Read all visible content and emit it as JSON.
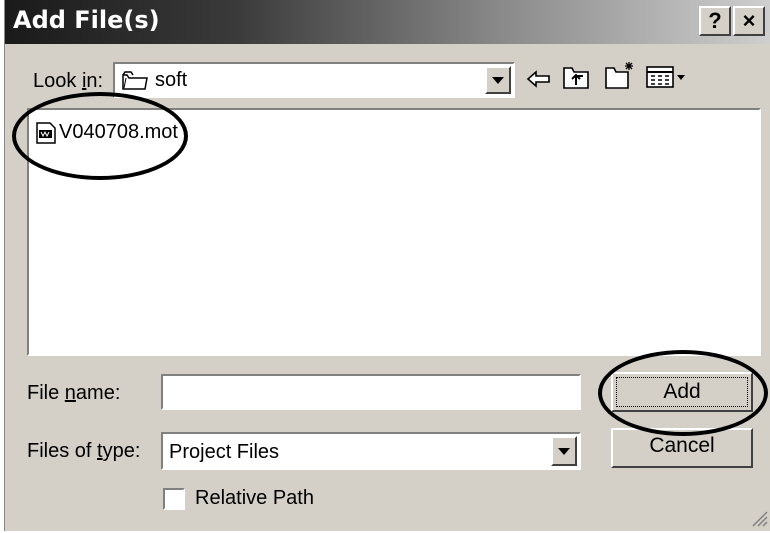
{
  "window": {
    "title": "Add File(s)",
    "help_label": "?",
    "close_label": "×"
  },
  "lookin": {
    "label_pre": "Look ",
    "label_u": "i",
    "label_post": "n:",
    "folder": "soft",
    "icons": [
      "back-arrow-icon",
      "up-folder-icon",
      "new-folder-icon",
      "view-menu-icon"
    ]
  },
  "files": [
    {
      "name": "V040708.mot",
      "icon": "mot-file-icon"
    }
  ],
  "filename": {
    "label_pre": "File ",
    "label_u": "n",
    "label_post": "ame:",
    "value": ""
  },
  "filetype": {
    "label_pre": "Files of ",
    "label_u": "t",
    "label_post": "ype:",
    "selected": "Project Files"
  },
  "buttons": {
    "add_label": "Add",
    "cancel_label": "Cancel"
  },
  "relative_path": {
    "label": "Relative Path",
    "checked": false
  }
}
